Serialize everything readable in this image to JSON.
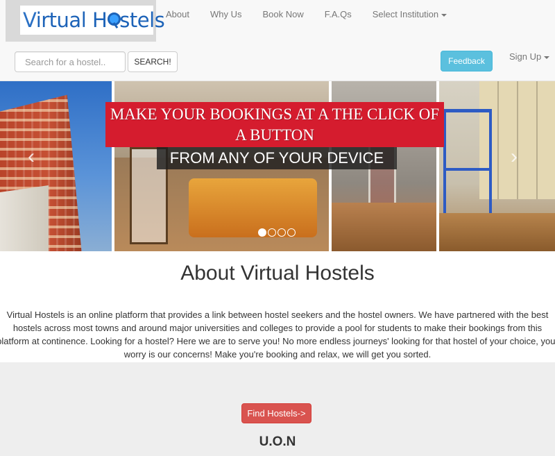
{
  "brand": {
    "logo_part1": "V",
    "logo_part2": "irtual H",
    "logo_part3": "stels"
  },
  "nav": {
    "items": [
      {
        "label": "About"
      },
      {
        "label": "Why Us"
      },
      {
        "label": "Book Now"
      },
      {
        "label": "F.A.Qs"
      },
      {
        "label": "Select Institution"
      }
    ]
  },
  "search": {
    "placeholder": "Search for a hostel..",
    "button_label": "SEARCH!"
  },
  "header_actions": {
    "feedback_label": "Feedback",
    "signup_label": "Sign Up"
  },
  "carousel": {
    "headline": "MAKE YOUR BOOKINGS AT A THE CLICK OF A BUTTON",
    "subheadline": "FROM ANY OF YOUR DEVICE",
    "prev_icon": "chevron-left-icon",
    "next_icon": "chevron-right-icon",
    "slide_count": 4,
    "active_slide": 1
  },
  "about": {
    "title": "About Virtual Hostels",
    "text": "Virtual Hostels is an online platform that provides a link between hostel seekers and the hostel owners. We have partnered with the best hostels across most towns and around major universities and colleges to provide a pool for students to make their bookings from this platform at continence. Looking for a hostel? Here we are to serve you! No more endless journeys' looking for that hostel of your choice, your worry is our concerns! Make you're booking and relax, we will get you sorted."
  },
  "cta": {
    "find_label": "Find Hostels->"
  },
  "institution": {
    "name": "U.O.N"
  },
  "colors": {
    "headline_bg": "#d51c2e",
    "feedback_bg": "#5bc0de",
    "find_bg": "#d9534f",
    "navbar_bg": "#f8f8f8"
  }
}
